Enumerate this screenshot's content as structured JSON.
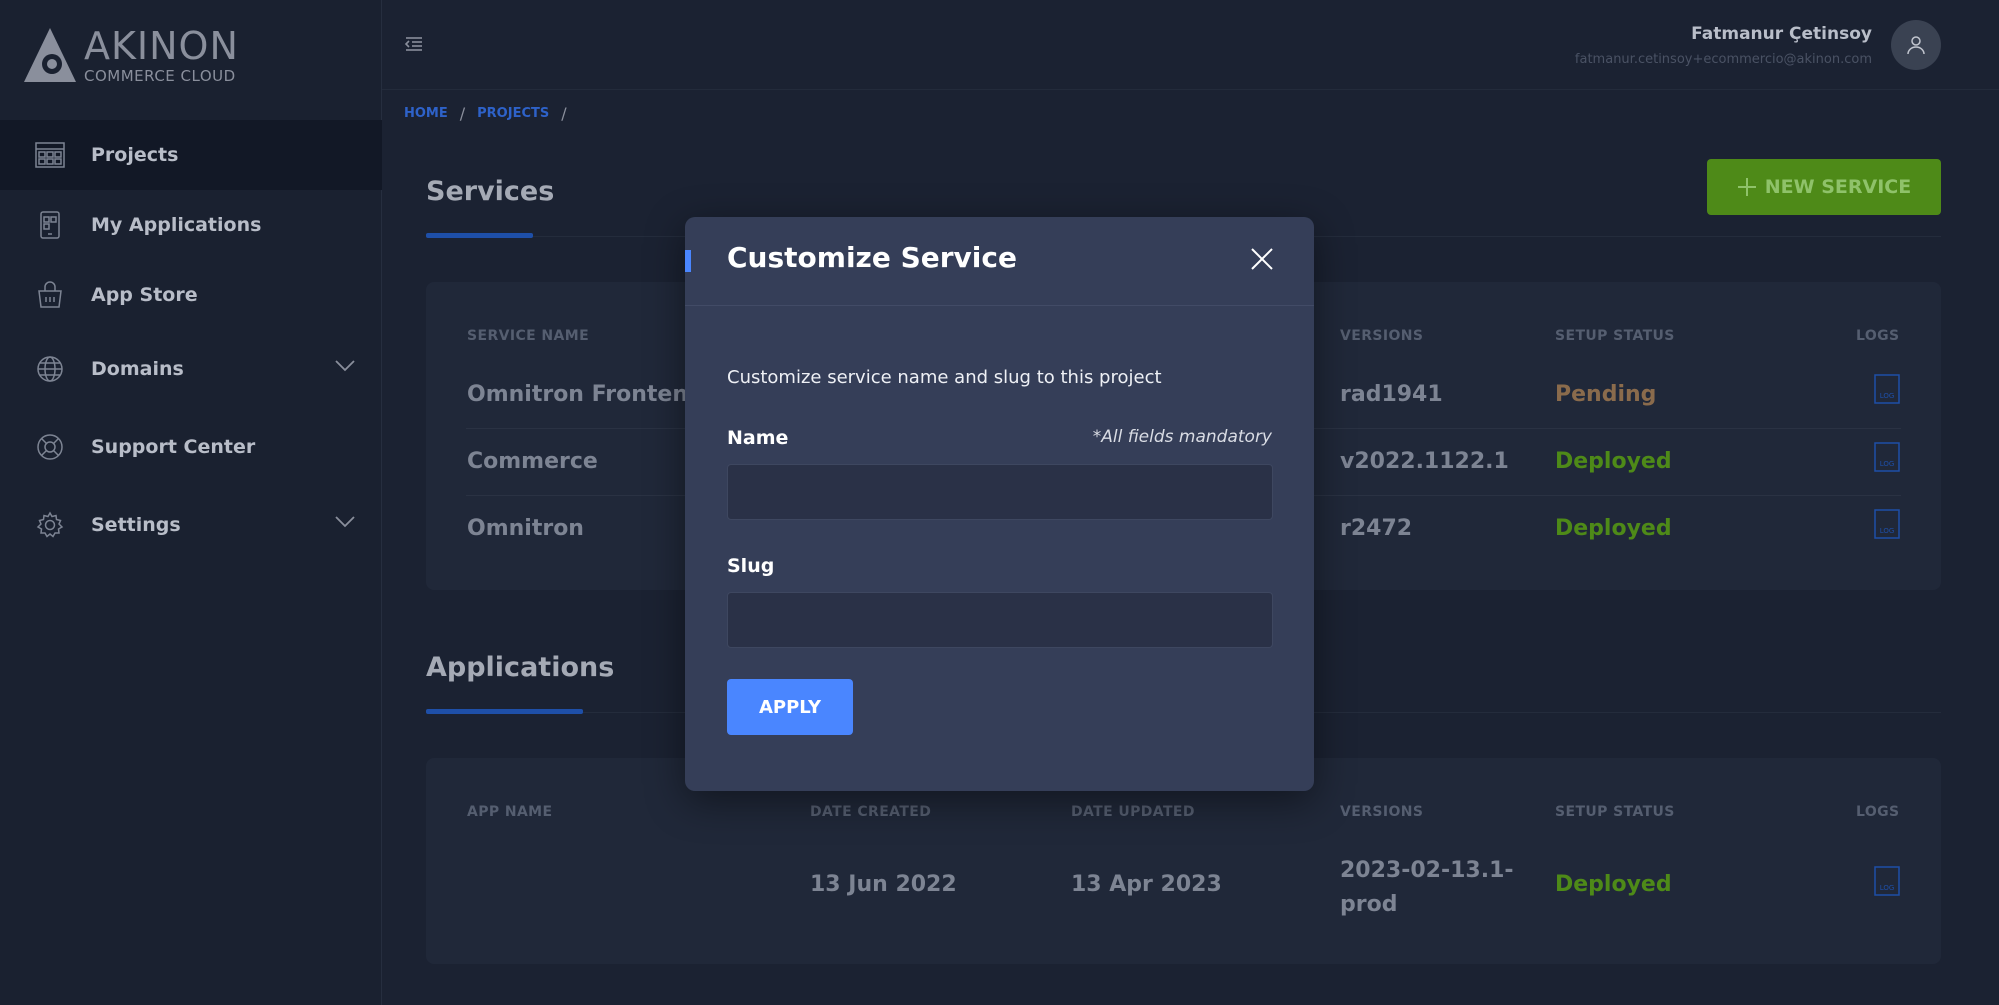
{
  "logo": {
    "main": "AKINON",
    "sub": "COMMERCE CLOUD"
  },
  "sidebar": {
    "items": [
      {
        "label": "Projects",
        "icon": "grid-icon"
      },
      {
        "label": "My Applications",
        "icon": "phone-apps-icon"
      },
      {
        "label": "App Store",
        "icon": "shopping-basket-icon"
      },
      {
        "label": "Domains",
        "icon": "globe-icon"
      },
      {
        "label": "Support Center",
        "icon": "lifebuoy-icon"
      },
      {
        "label": "Settings",
        "icon": "gear-icon"
      }
    ]
  },
  "user": {
    "name": "Fatmanur Çetinsoy",
    "email": "fatmanur.cetinsoy+ecommercio@akinon.com"
  },
  "breadcrumb": {
    "home": "HOME",
    "projects": "PROJECTS",
    "sep": "/"
  },
  "services": {
    "title": "Services",
    "new_button": "NEW SERVICE",
    "columns": {
      "name": "SERVICE NAME",
      "versions": "VERSIONS",
      "status": "SETUP STATUS",
      "logs": "LOGS"
    },
    "rows": [
      {
        "name": "Omnitron Frontend",
        "version": "rad1941",
        "status": "Pending"
      },
      {
        "name": "Commerce",
        "version": "v2022.1122.1",
        "status": "Deployed"
      },
      {
        "name": "Omnitron",
        "version": "r2472",
        "status": "Deployed"
      }
    ]
  },
  "applications": {
    "title": "Applications",
    "columns": {
      "name": "APP NAME",
      "created": "DATE CREATED",
      "updated": "DATE UPDATED",
      "versions": "VERSIONS",
      "status": "SETUP STATUS",
      "logs": "LOGS"
    },
    "rows": [
      {
        "name": "",
        "created": "13 Jun 2022",
        "updated": "13 Apr 2023",
        "version_line1": "2023-02-13.1-",
        "version_line2": "prod",
        "status": "Deployed"
      }
    ]
  },
  "modal": {
    "title": "Customize Service",
    "description": "Customize service name and slug to this project",
    "name_label": "Name",
    "mandatory_note": "*All fields mandatory",
    "name_value": "",
    "slug_label": "Slug",
    "slug_value": "",
    "apply_label": "APPLY"
  },
  "colors": {
    "accent": "#4a86ff",
    "deployed": "#4e8a18",
    "pending": "#8a6b4c",
    "new_service_bg": "#4e8a18"
  }
}
